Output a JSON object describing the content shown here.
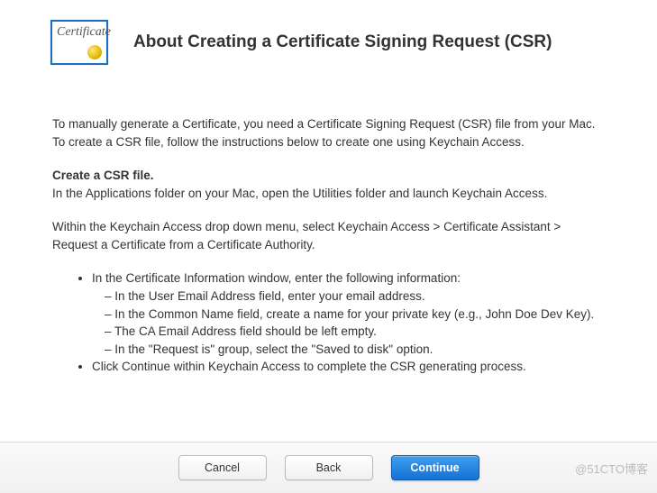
{
  "icon": {
    "label": "Certificate"
  },
  "title": "About Creating a Certificate Signing Request (CSR)",
  "intro": "To manually generate a Certificate, you need a Certificate Signing Request (CSR) file from your Mac. To create a CSR file, follow the instructions below to create one using Keychain Access.",
  "section_heading": "Create a CSR file.",
  "step1": "In the Applications folder on your Mac, open the Utilities folder and launch Keychain Access.",
  "step2": "Within the Keychain Access drop down menu, select Keychain Access > Certificate Assistant > Request a Certificate from a Certificate Authority.",
  "bullets": {
    "b1": "In the Certificate Information window, enter the following information:",
    "sub": {
      "s1": "In the User Email Address field, enter your email address.",
      "s2": "In the Common Name field, create a name for your private key (e.g., John Doe Dev Key).",
      "s3": "The CA Email Address field should be left empty.",
      "s4": "In the \"Request is\" group, select the \"Saved to disk\" option."
    },
    "b2": "Click Continue within Keychain Access to complete the CSR generating process."
  },
  "buttons": {
    "cancel": "Cancel",
    "back": "Back",
    "continue": "Continue"
  },
  "watermark": "@51CTO博客"
}
